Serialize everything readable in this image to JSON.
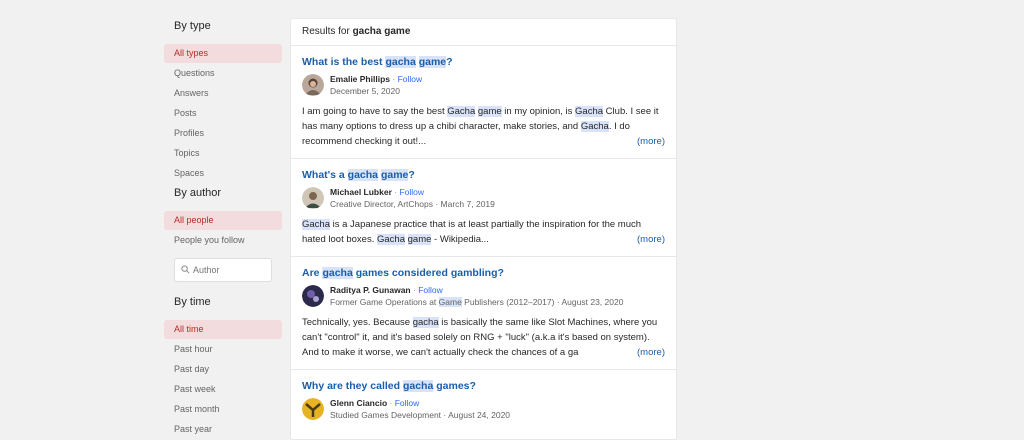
{
  "sidebar": {
    "by_type": {
      "title": "By type",
      "items": [
        "All types",
        "Questions",
        "Answers",
        "Posts",
        "Profiles",
        "Topics",
        "Spaces"
      ]
    },
    "by_author": {
      "title": "By author",
      "items": [
        "All people",
        "People you follow"
      ],
      "search_placeholder": "Author"
    },
    "by_time": {
      "title": "By time",
      "items": [
        "All time",
        "Past hour",
        "Past day",
        "Past week",
        "Past month",
        "Past year"
      ]
    }
  },
  "results": {
    "prefix": "Results for",
    "query": "gacha game",
    "items": [
      {
        "question": [
          "What is the best ",
          "gacha",
          " ",
          "game",
          "?"
        ],
        "author": "Emalie Phillips",
        "follow": "Follow",
        "credential": "December 5, 2020",
        "snippet": [
          "I am going to have to say the best ",
          "Gacha",
          " ",
          "game",
          " in my opinion, is ",
          "Gacha",
          " Club. I see it has many options to dress up a chibi character, make stories, and ",
          "Gacha",
          ". I do recommend checking it out!..."
        ],
        "more": "(more)"
      },
      {
        "question": [
          "What's a ",
          "gacha",
          " ",
          "game",
          "?"
        ],
        "author": "Michael Lubker",
        "follow": "Follow",
        "credential": "Creative Director, ArtChops · March 7, 2019",
        "snippet": [
          "",
          "Gacha",
          " is a Japanese practice that is at least partially the inspiration for the much hated loot boxes. ",
          "Gacha",
          " ",
          "game",
          " - Wikipedia..."
        ],
        "more": "(more)"
      },
      {
        "question": [
          "Are ",
          "gacha",
          " games considered gambling?"
        ],
        "author": "Raditya P. Gunawan",
        "follow": "Follow",
        "credential": [
          "Former Game Operations at ",
          "Game",
          " Publishers (2012–2017) · August 23, 2020"
        ],
        "snippet": [
          "Technically, yes. Because ",
          "gacha",
          " is basically the same like Slot Machines, where you can't \"control\" it, and it's based solely on RNG + \"luck\" (a.k.a it's based on system). And to make it worse, we can't actually check the chances of a ga"
        ],
        "more": "(more)"
      },
      {
        "question": [
          "Why are they called ",
          "gacha",
          " games?"
        ],
        "author": "Glenn Ciancio",
        "follow": "Follow",
        "credential": "Studied Games Development · August 24, 2020",
        "snippet": [],
        "more": ""
      }
    ]
  },
  "colors": {
    "accent_red": "#b92b27",
    "active_bg": "#f2dcdd",
    "link_blue": "#195faa",
    "follow_blue": "#2e69ff",
    "highlight": "#d8e2f8"
  }
}
